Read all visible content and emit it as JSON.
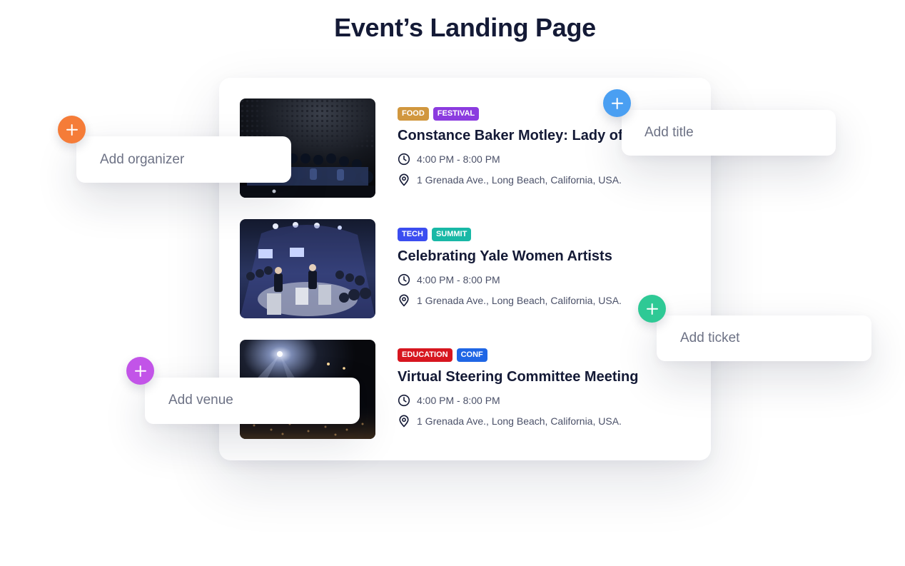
{
  "page": {
    "title": "Event’s Landing Page"
  },
  "events": [
    {
      "tags": [
        {
          "label": "FOOD",
          "color": "#d1973e"
        },
        {
          "label": "FESTIVAL",
          "color": "#8b3bdf"
        }
      ],
      "title": "Constance Baker Motley: Lady of the Law",
      "time": "4:00 PM - 8:00 PM",
      "location": "1 Grenada Ave., Long Beach, California, USA."
    },
    {
      "tags": [
        {
          "label": "TECH",
          "color": "#3b4df0"
        },
        {
          "label": "SUMMIT",
          "color": "#19b8a6"
        }
      ],
      "title": "Celebrating Yale Women Artists",
      "time": "4:00 PM - 8:00 PM",
      "location": "1 Grenada Ave., Long Beach, California, USA."
    },
    {
      "tags": [
        {
          "label": "EDUCATION",
          "color": "#d7161f"
        },
        {
          "label": "CONF",
          "color": "#1f66e5"
        }
      ],
      "title": "Virtual Steering Committee Meeting",
      "time": "4:00 PM - 8:00 PM",
      "location": "1 Grenada Ave., Long Beach, California, USA."
    }
  ],
  "add_fields": {
    "organizer": {
      "label": "Add organizer",
      "color": "#f57c38",
      "icon": "plus-icon"
    },
    "title": {
      "label": "Add title",
      "color": "#4a9ff2",
      "icon": "plus-icon"
    },
    "ticket": {
      "label": "Add ticket",
      "color": "#2ec995",
      "icon": "plus-icon"
    },
    "venue": {
      "label": "Add venue",
      "color": "#c254e8",
      "icon": "plus-icon"
    }
  },
  "icons": {
    "time": "clock-icon",
    "location": "map-pin-icon"
  }
}
